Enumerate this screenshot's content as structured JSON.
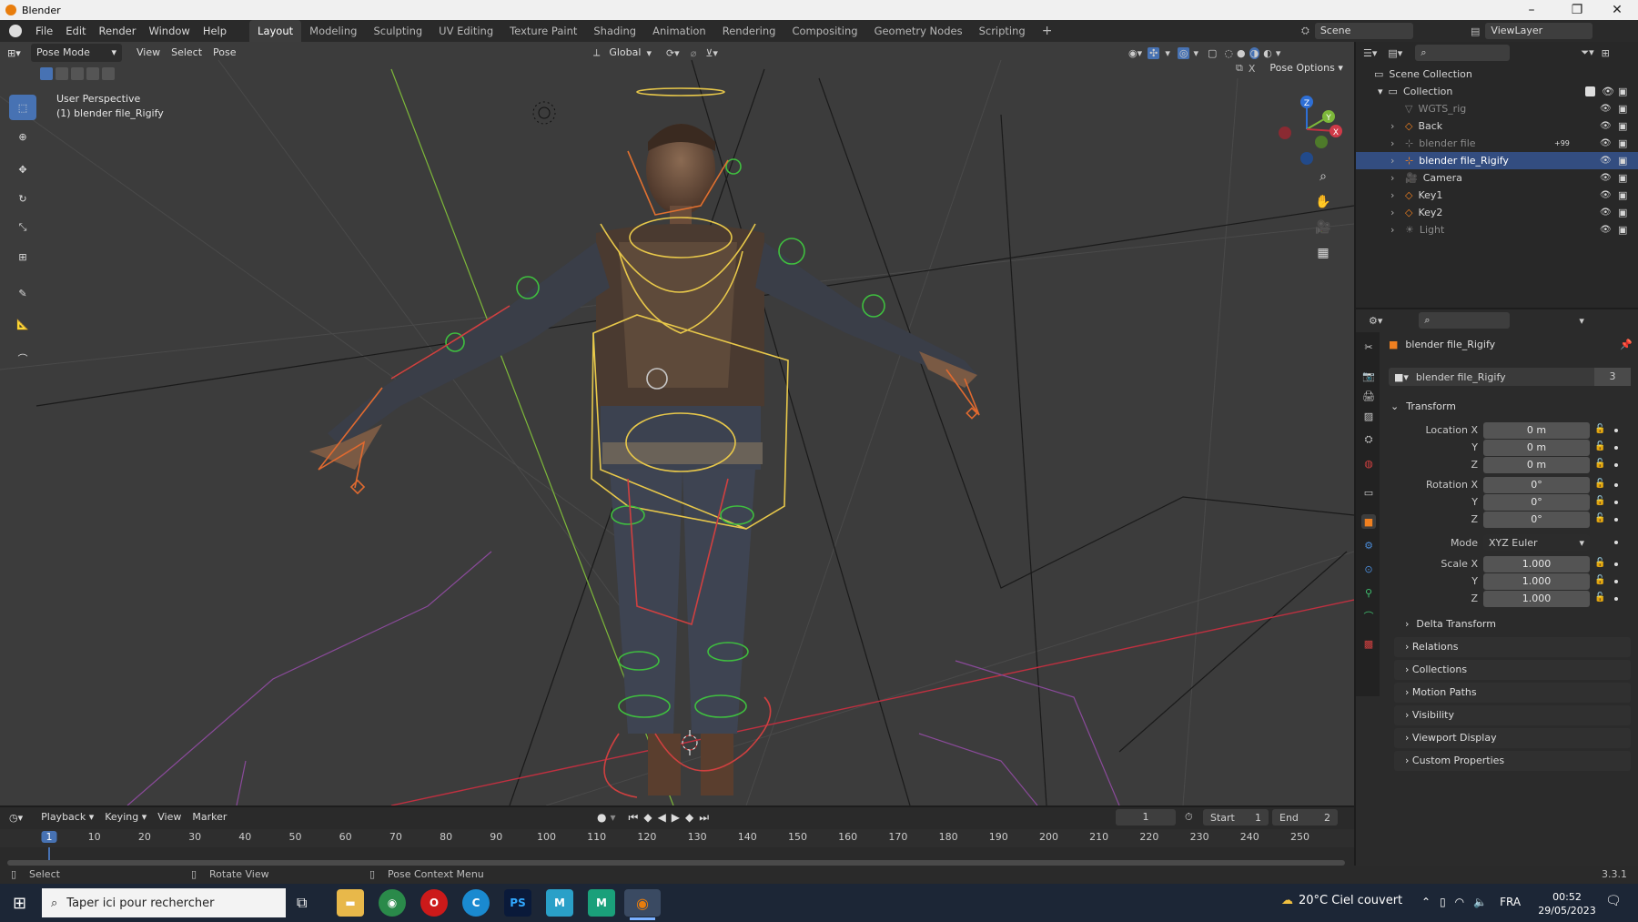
{
  "window": {
    "title": "Blender"
  },
  "topbar": {
    "menus": [
      "File",
      "Edit",
      "Render",
      "Window",
      "Help"
    ],
    "workspaces": [
      "Layout",
      "Modeling",
      "Sculpting",
      "UV Editing",
      "Texture Paint",
      "Shading",
      "Animation",
      "Rendering",
      "Compositing",
      "Geometry Nodes",
      "Scripting"
    ],
    "active_workspace": "Layout",
    "add_tab": "+",
    "scene": "Scene",
    "view_layer": "ViewLayer"
  },
  "viewport": {
    "mode": "Pose Mode",
    "menus": [
      "View",
      "Select",
      "Pose"
    ],
    "orientation": "Global",
    "overlay_title": "User Perspective",
    "overlay_object": "(1) blender file_Rigify",
    "pose_options": "Pose Options",
    "gizmo_z": "Z",
    "gizmo_y": "Y",
    "gizmo_x": "X"
  },
  "outliner": {
    "root": "Scene Collection",
    "collection": "Collection",
    "items": [
      {
        "name": "WGTS_rig",
        "dim": true
      },
      {
        "name": "Back",
        "dim": false
      },
      {
        "name": "blender file",
        "dim": true,
        "badge": "+99"
      },
      {
        "name": "blender file_Rigify",
        "dim": false,
        "selected": true
      },
      {
        "name": "Camera",
        "dim": false
      },
      {
        "name": "Key1",
        "dim": false
      },
      {
        "name": "Key2",
        "dim": false
      },
      {
        "name": "Light",
        "dim": true
      }
    ]
  },
  "properties": {
    "object_name": "blender file_Rigify",
    "datablock": "blender file_Rigify",
    "users": "3",
    "transform_header": "Transform",
    "location_label": "Location X",
    "rotation_label": "Rotation X",
    "scale_label": "Scale X",
    "y": "Y",
    "z": "Z",
    "mode_label": "Mode",
    "location": [
      "0 m",
      "0 m",
      "0 m"
    ],
    "rotation": [
      "0°",
      "0°",
      "0°"
    ],
    "rotation_mode": "XYZ Euler",
    "scale": [
      "1.000",
      "1.000",
      "1.000"
    ],
    "subpanels": [
      "Delta Transform"
    ],
    "panels": [
      "Relations",
      "Collections",
      "Motion Paths",
      "Visibility",
      "Viewport Display",
      "Custom Properties"
    ]
  },
  "timeline": {
    "menus": [
      "Playback",
      "Keying",
      "View",
      "Marker"
    ],
    "current_frame": "1",
    "start_label": "Start",
    "start": "1",
    "end_label": "End",
    "end": "2",
    "ruler": [
      "1",
      "10",
      "20",
      "30",
      "40",
      "50",
      "60",
      "70",
      "80",
      "90",
      "100",
      "110",
      "120",
      "130",
      "140",
      "150",
      "160",
      "170",
      "180",
      "190",
      "200",
      "210",
      "220",
      "230",
      "240",
      "250"
    ]
  },
  "statusbar": {
    "select": "Select",
    "rotate": "Rotate View",
    "context": "Pose Context Menu",
    "version": "3.3.1"
  },
  "taskbar": {
    "search_placeholder": "Taper ici pour rechercher",
    "weather": "20°C  Ciel couvert",
    "language": "FRA",
    "time": "00:52",
    "date": "29/05/2023",
    "apps": [
      "PS",
      "M",
      "M"
    ]
  },
  "colors": {
    "accent": "#4772b3",
    "selected_row": "#334d80",
    "bone_yellow": "#e8c84a",
    "bone_green": "#3fbf3f",
    "bone_red": "#d04040",
    "bone_orange": "#e06a30",
    "axis_red": "#c03040",
    "axis_green": "#7db83a"
  }
}
